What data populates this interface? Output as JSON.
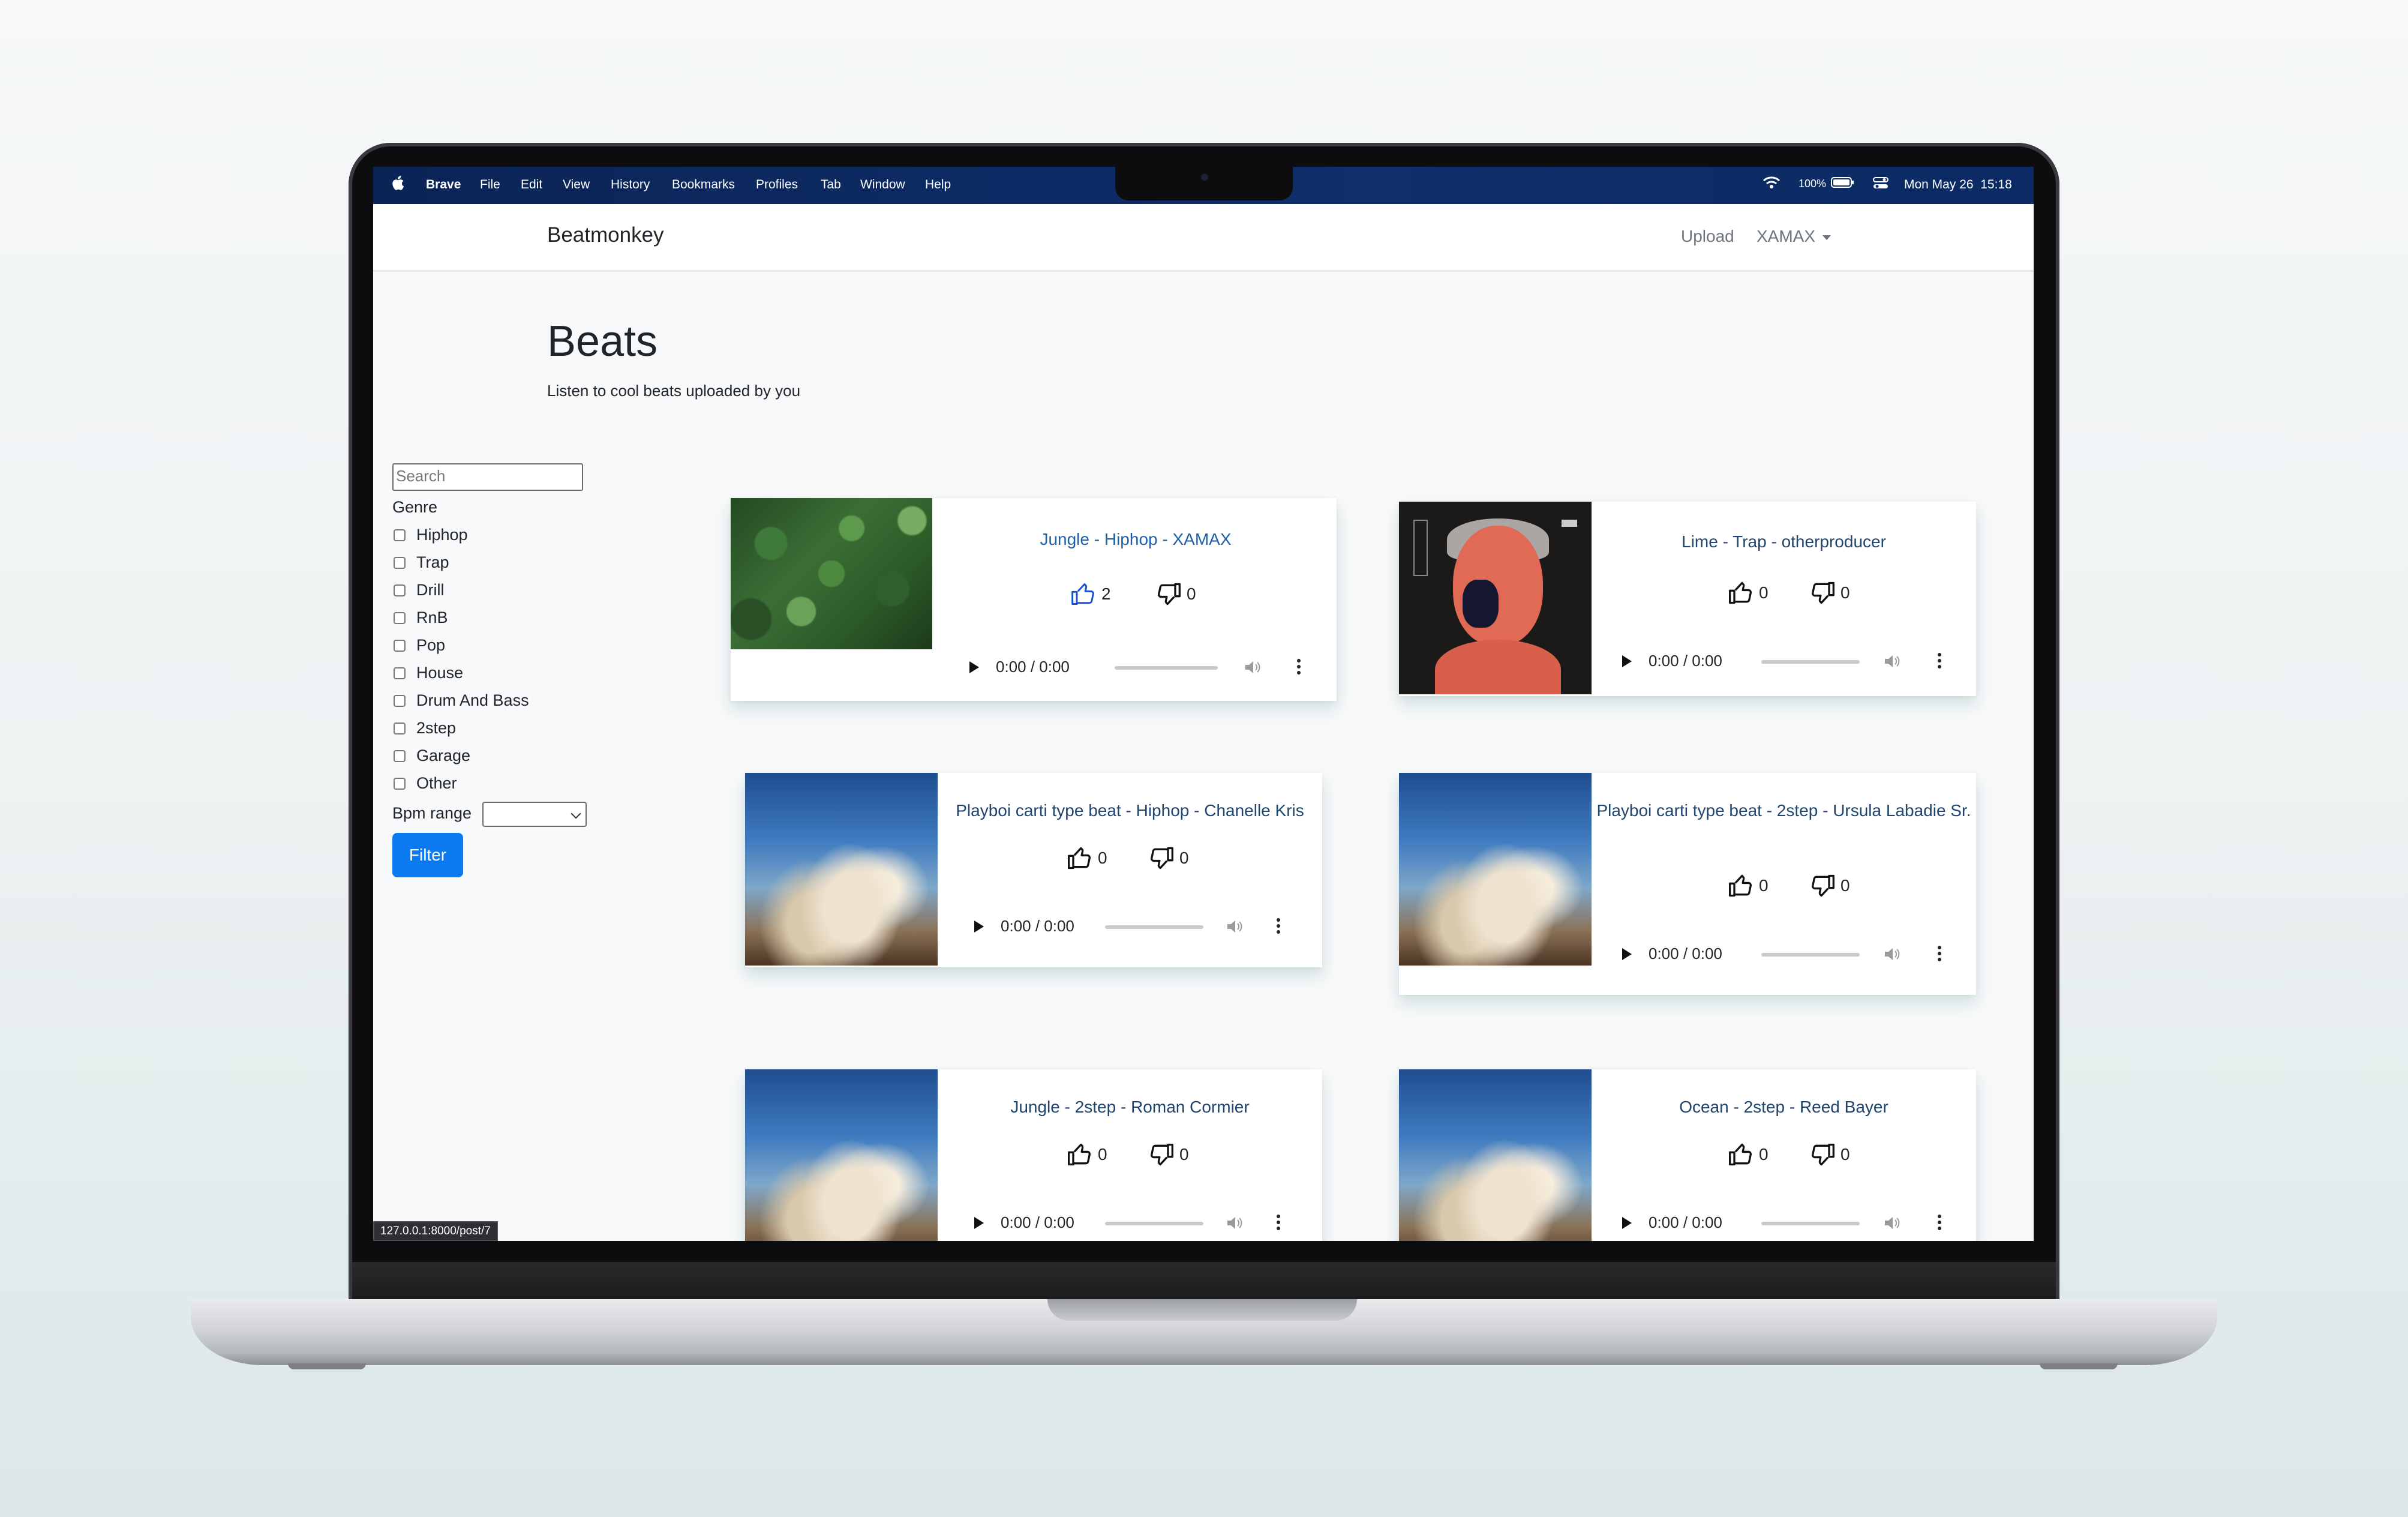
{
  "menubar": {
    "items": [
      "Brave",
      "File",
      "Edit",
      "View",
      "History",
      "Bookmarks",
      "Profiles",
      "Tab",
      "Window",
      "Help"
    ],
    "battery": "100%",
    "clock": "Mon May 26  15:18"
  },
  "navbar": {
    "brand": "Beatmonkey",
    "upload": "Upload",
    "user": "XAMAX"
  },
  "header": {
    "title": "Beats",
    "subtitle": "Listen to cool beats uploaded by you"
  },
  "sidebar": {
    "search_placeholder": "Search",
    "genre_label": "Genre",
    "genres": [
      "Hiphop",
      "Trap",
      "Drill",
      "RnB",
      "Pop",
      "House",
      "Drum And Bass",
      "2step",
      "Garage",
      "Other"
    ],
    "bpm_label": "Bpm range",
    "filter_label": "Filter"
  },
  "beats": [
    {
      "title": "Jungle - Hiphop - XAMAX",
      "likes": "2",
      "dislikes": "0",
      "time": "0:00 / 0:00",
      "image": "leaves"
    },
    {
      "title": "Lime - Trap - otherproducer",
      "likes": "0",
      "dislikes": "0",
      "time": "0:00 / 0:00",
      "image": "face-art"
    },
    {
      "title": "Playboi carti type beat - Hiphop - Chanelle Kris",
      "likes": "0",
      "dislikes": "0",
      "time": "0:00 / 0:00",
      "image": "sky-clouds"
    },
    {
      "title": "Playboi carti type beat - 2step - Ursula Labadie Sr.",
      "likes": "0",
      "dislikes": "0",
      "time": "0:00 / 0:00",
      "image": "sky-clouds"
    },
    {
      "title": "Jungle - 2step - Roman Cormier",
      "likes": "0",
      "dislikes": "0",
      "time": "0:00 / 0:00",
      "image": "sky-clouds"
    },
    {
      "title": "Ocean - 2step - Reed Bayer",
      "likes": "0",
      "dislikes": "0",
      "time": "0:00 / 0:00",
      "image": "sky-clouds"
    }
  ],
  "status_url": "127.0.0.1:8000/post/7",
  "colors": {
    "accent": "#0d7bf0",
    "link": "#1f5fa8",
    "menubar": "#0e2f6c"
  }
}
